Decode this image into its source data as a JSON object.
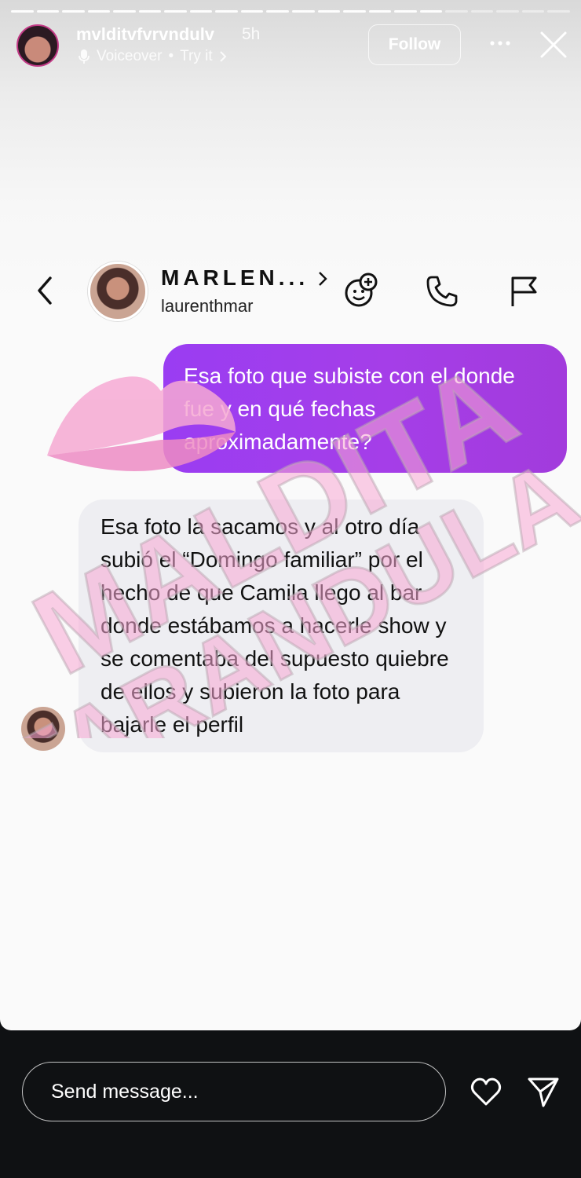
{
  "story_header": {
    "username": "mvlditvfvrvndulv",
    "time": "5h",
    "voiceover_label": "Voiceover",
    "try_it_label": "Try it",
    "follow_label": "Follow",
    "avatar_logo_text": "MALDITA FARANDULA"
  },
  "dm_header": {
    "name": "MARLEN...",
    "handle": "laurenthmar"
  },
  "messages": {
    "outgoing": "Esa foto que subiste con el donde fue y en qué fechas aproximadamente?",
    "incoming": "Esa foto la sacamos y al otro día subió el “Domingo familiar” por el hecho de que Camila llego al bar donde estábamos a hacerle show y se comentaba del supuesto quiebre de ellos y subieron la foto para bajarle el perfil"
  },
  "watermark": {
    "line1": "MALDITA",
    "line2": "FARANDULA"
  },
  "footer": {
    "send_placeholder": "Send message..."
  },
  "colors": {
    "outgoing_bubble": "#a23de6",
    "incoming_bubble": "#eeeef2",
    "watermark_pink": "#f7a8d4",
    "background": "#0f1113"
  },
  "progress": {
    "segments": 22,
    "filled": 17
  }
}
